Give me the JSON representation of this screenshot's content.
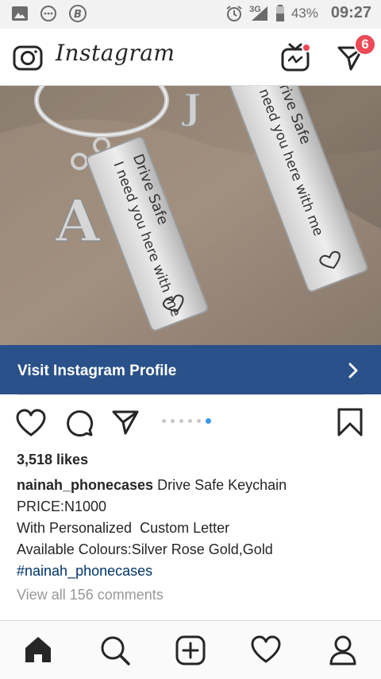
{
  "status_bar": {
    "network": "3G",
    "battery": "43%",
    "time": "09:27"
  },
  "header": {
    "app_name": "Instagram",
    "direct_badge": "6"
  },
  "post": {
    "tag_text_line1": "Drive Safe",
    "tag_text_line2": "I need you here with me",
    "visit_profile_label": "Visit Instagram Profile",
    "carousel": {
      "count": 6,
      "active_index": 5
    },
    "likes": "3,518 likes",
    "caption": {
      "username": "nainah_phonecases",
      "title": "Drive Safe Keychain",
      "price": "PRICE:N1000",
      "line3": "With Personalized  Custom Letter",
      "line4": "Available Colours:Silver Rose Gold,Gold",
      "hashtag": "#nainah_phonecases"
    },
    "view_comments": "View all 156 comments"
  },
  "bottom_nav": {
    "items": [
      "home-icon",
      "search-icon",
      "add-post-icon",
      "activity-heart-icon",
      "profile-icon"
    ]
  },
  "colors": {
    "accent_blue": "#2a5189",
    "notification_red": "#ed4956",
    "hashtag": "#003569",
    "carousel_active": "#3897f0"
  }
}
